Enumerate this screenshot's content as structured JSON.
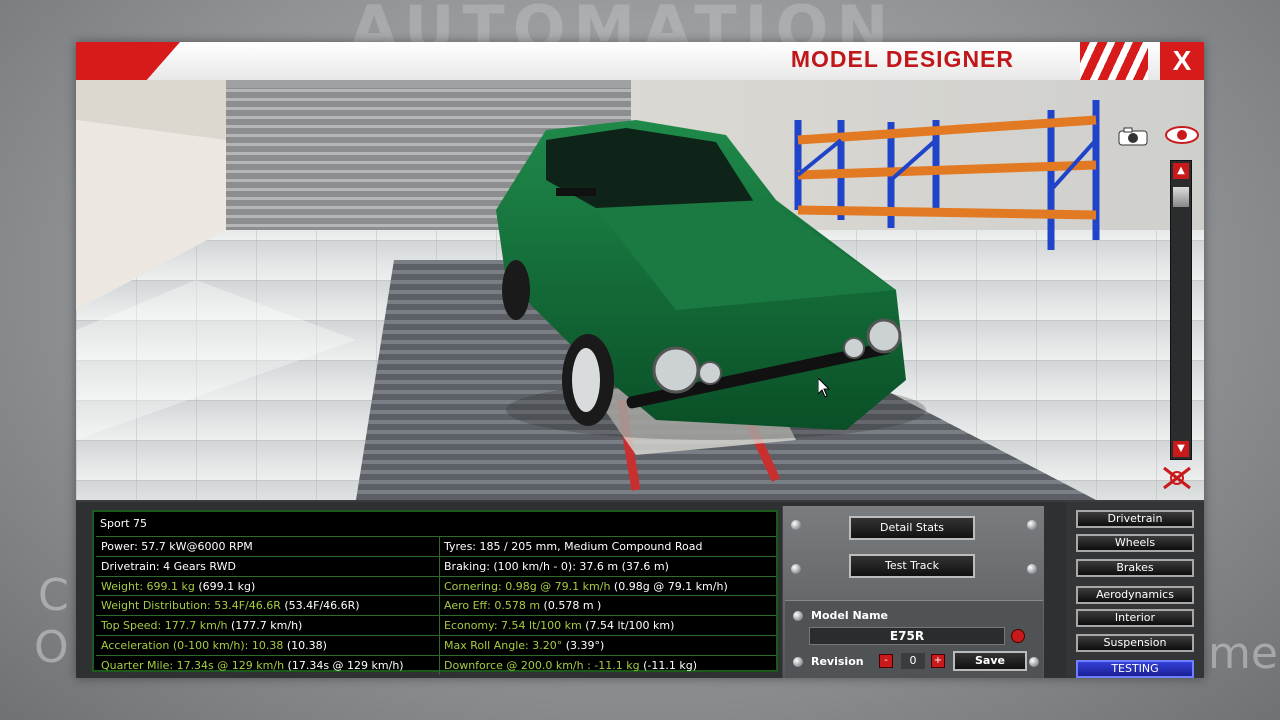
{
  "background": {
    "logo_text": "AUTOMATION",
    "left_letter_1": "C",
    "left_letter_2": "O",
    "right_text": "me"
  },
  "window": {
    "title": "MODEL DESIGNER",
    "close_label": "X"
  },
  "viewport": {
    "icons": [
      "camera-icon",
      "eye-icon",
      "arrow-up-icon",
      "arrow-down-icon",
      "reset-view-icon"
    ]
  },
  "stats": {
    "title": "Sport 75",
    "rows": [
      {
        "left": "Power: 57.7 kW@6000 RPM",
        "left_color": "white",
        "right": "Tyres: 185 / 205 mm, Medium Compound Road",
        "right_color": "white"
      },
      {
        "left": "Drivetrain: 4 Gears RWD",
        "left_color": "white",
        "right": "Braking: (100 km/h - 0): 37.6 m (37.6 m)",
        "right_color": "white"
      },
      {
        "left": "Weight: 699.1 kg",
        "left_extra": " (699.1 kg)",
        "left_color": "green",
        "right": "Cornering: 0.98g @ 79.1 km/h",
        "right_extra": " (0.98g @ 79.1 km/h)",
        "right_color": "green"
      },
      {
        "left": "Weight Distribution: 53.4F/46.6R",
        "left_extra": " (53.4F/46.6R)",
        "left_color": "green",
        "right": "Aero Eff: 0.578 m",
        "right_extra": "  (0.578 m )",
        "right_color": "green"
      },
      {
        "left": "Top Speed: 177.7 km/h",
        "left_extra": " (177.7 km/h)",
        "left_color": "green",
        "right": "Economy: 7.54 lt/100 km",
        "right_extra": " (7.54 lt/100 km)",
        "right_color": "green"
      },
      {
        "left": "Acceleration (0-100 km/h): 10.38",
        "left_extra": " (10.38)",
        "left_color": "green",
        "right": "Max Roll Angle: 3.20°",
        "right_extra": " (3.39°)",
        "right_color": "green"
      },
      {
        "left": "Quarter Mile: 17.34s @ 129 km/h",
        "left_extra": " (17.34s @ 129 km/h)",
        "left_color": "green",
        "right": "Downforce @ 200.0 km/h : -11.1 kg",
        "right_extra": " (-11.1 kg)",
        "right_color": "green"
      }
    ]
  },
  "actions": {
    "detail_stats": "Detail Stats",
    "test_track": "Test Track"
  },
  "model": {
    "name_label": "Model Name",
    "name_value": "E75R",
    "revision_label": "Revision",
    "revision_value": "0",
    "minus": "-",
    "plus": "+",
    "save_label": "Save"
  },
  "nav": {
    "items": [
      "Drivetrain",
      "Wheels",
      "Brakes",
      "Aerodynamics",
      "Interior",
      "Suspension",
      "TESTING"
    ],
    "active": "TESTING"
  },
  "colors": {
    "brand_red": "#d71a1a",
    "stat_green": "#a5cc42",
    "active_blue": "#2a35c4",
    "car_green": "#0e6b36"
  }
}
